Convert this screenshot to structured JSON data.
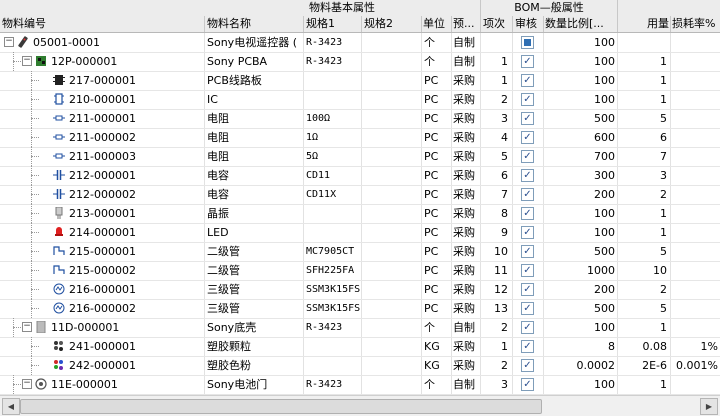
{
  "header": {
    "group_basic": "物料基本属性",
    "group_bom": "BOM—般属性",
    "columns": {
      "code": "物料编号",
      "name": "物料名称",
      "spec1": "规格1",
      "spec2": "规格2",
      "unit": "单位",
      "pre": "预...",
      "seq": "项次",
      "audit": "审核",
      "ratio": "数量比例[...",
      "usage": "用量",
      "loss": "损耗率%"
    }
  },
  "rows": [
    {
      "code": "05001-0001",
      "name": "Sony电视遥控器 (",
      "spec1": "R-3423",
      "unit": "个",
      "pre": "自制",
      "seq": "",
      "audit": "filled",
      "ratio": "100",
      "usage": "",
      "loss": "",
      "icon": "remote-icon"
    },
    {
      "code": "12P-000001",
      "name": "Sony PCBA",
      "spec1": "R-3423",
      "unit": "个",
      "pre": "自制",
      "seq": "1",
      "audit": "checked",
      "ratio": "100",
      "usage": "1",
      "loss": "",
      "icon": "pcba-icon"
    },
    {
      "code": "217-000001",
      "name": "PCB线路板",
      "spec1": "",
      "unit": "PC",
      "pre": "采购",
      "seq": "1",
      "audit": "checked",
      "ratio": "100",
      "usage": "1",
      "loss": "",
      "icon": "pcb-icon"
    },
    {
      "code": "210-000001",
      "name": "IC",
      "spec1": "",
      "unit": "PC",
      "pre": "采购",
      "seq": "2",
      "audit": "checked",
      "ratio": "100",
      "usage": "1",
      "loss": "",
      "icon": "ic-icon"
    },
    {
      "code": "211-000001",
      "name": "电阻",
      "spec1": "100Ω",
      "unit": "PC",
      "pre": "采购",
      "seq": "3",
      "audit": "checked",
      "ratio": "500",
      "usage": "5",
      "loss": "",
      "icon": "resistor-icon"
    },
    {
      "code": "211-000002",
      "name": "电阻",
      "spec1": "1Ω",
      "unit": "PC",
      "pre": "采购",
      "seq": "4",
      "audit": "checked",
      "ratio": "600",
      "usage": "6",
      "loss": "",
      "icon": "resistor-icon"
    },
    {
      "code": "211-000003",
      "name": "电阻",
      "spec1": "5Ω",
      "unit": "PC",
      "pre": "采购",
      "seq": "5",
      "audit": "checked",
      "ratio": "700",
      "usage": "7",
      "loss": "",
      "icon": "resistor-icon"
    },
    {
      "code": "212-000001",
      "name": "电容",
      "spec1": "CD11",
      "unit": "PC",
      "pre": "采购",
      "seq": "6",
      "audit": "checked",
      "ratio": "300",
      "usage": "3",
      "loss": "",
      "icon": "capacitor-icon"
    },
    {
      "code": "212-000002",
      "name": "电容",
      "spec1": "CD11X",
      "unit": "PC",
      "pre": "采购",
      "seq": "7",
      "audit": "checked",
      "ratio": "200",
      "usage": "2",
      "loss": "",
      "icon": "capacitor-icon"
    },
    {
      "code": "213-000001",
      "name": "晶振",
      "spec1": "",
      "unit": "PC",
      "pre": "采购",
      "seq": "8",
      "audit": "checked",
      "ratio": "100",
      "usage": "1",
      "loss": "",
      "icon": "crystal-icon"
    },
    {
      "code": "214-000001",
      "name": "LED",
      "spec1": "",
      "unit": "PC",
      "pre": "采购",
      "seq": "9",
      "audit": "checked",
      "ratio": "100",
      "usage": "1",
      "loss": "",
      "icon": "led-icon"
    },
    {
      "code": "215-000001",
      "name": "二级管",
      "spec1": "MC7905CT",
      "unit": "PC",
      "pre": "采购",
      "seq": "10",
      "audit": "checked",
      "ratio": "500",
      "usage": "5",
      "loss": "",
      "icon": "diode-icon"
    },
    {
      "code": "215-000002",
      "name": "二级管",
      "spec1": "SFH225FA",
      "unit": "PC",
      "pre": "采购",
      "seq": "11",
      "audit": "checked",
      "ratio": "1000",
      "usage": "10",
      "loss": "",
      "icon": "diode-icon"
    },
    {
      "code": "216-000001",
      "name": "三级管",
      "spec1": "SSM3K15FS",
      "unit": "PC",
      "pre": "采购",
      "seq": "12",
      "audit": "checked",
      "ratio": "200",
      "usage": "2",
      "loss": "",
      "icon": "transistor-icon"
    },
    {
      "code": "216-000002",
      "name": "三级管",
      "spec1": "SSM3K15FS",
      "unit": "PC",
      "pre": "采购",
      "seq": "13",
      "audit": "checked",
      "ratio": "500",
      "usage": "5",
      "loss": "",
      "icon": "transistor-icon"
    },
    {
      "code": "11D-000001",
      "name": "Sony底壳",
      "spec1": "R-3423",
      "unit": "个",
      "pre": "自制",
      "seq": "2",
      "audit": "checked",
      "ratio": "100",
      "usage": "1",
      "loss": "",
      "icon": "housing-icon"
    },
    {
      "code": "241-000001",
      "name": "塑胶颗粒",
      "spec1": "",
      "unit": "KG",
      "pre": "采购",
      "seq": "1",
      "audit": "checked",
      "ratio": "8",
      "usage": "0.08",
      "loss": "1%",
      "icon": "pellets-icon"
    },
    {
      "code": "242-000001",
      "name": "塑胶色粉",
      "spec1": "",
      "unit": "KG",
      "pre": "采购",
      "seq": "2",
      "audit": "checked",
      "ratio": "0.0002",
      "usage": "2E-6",
      "loss": "0.001%",
      "icon": "powder-icon"
    },
    {
      "code": "11E-000001",
      "name": "Sony电池门",
      "spec1": "R-3423",
      "unit": "个",
      "pre": "自制",
      "seq": "3",
      "audit": "checked",
      "ratio": "100",
      "usage": "1",
      "loss": "",
      "icon": "battery-door-icon"
    }
  ]
}
